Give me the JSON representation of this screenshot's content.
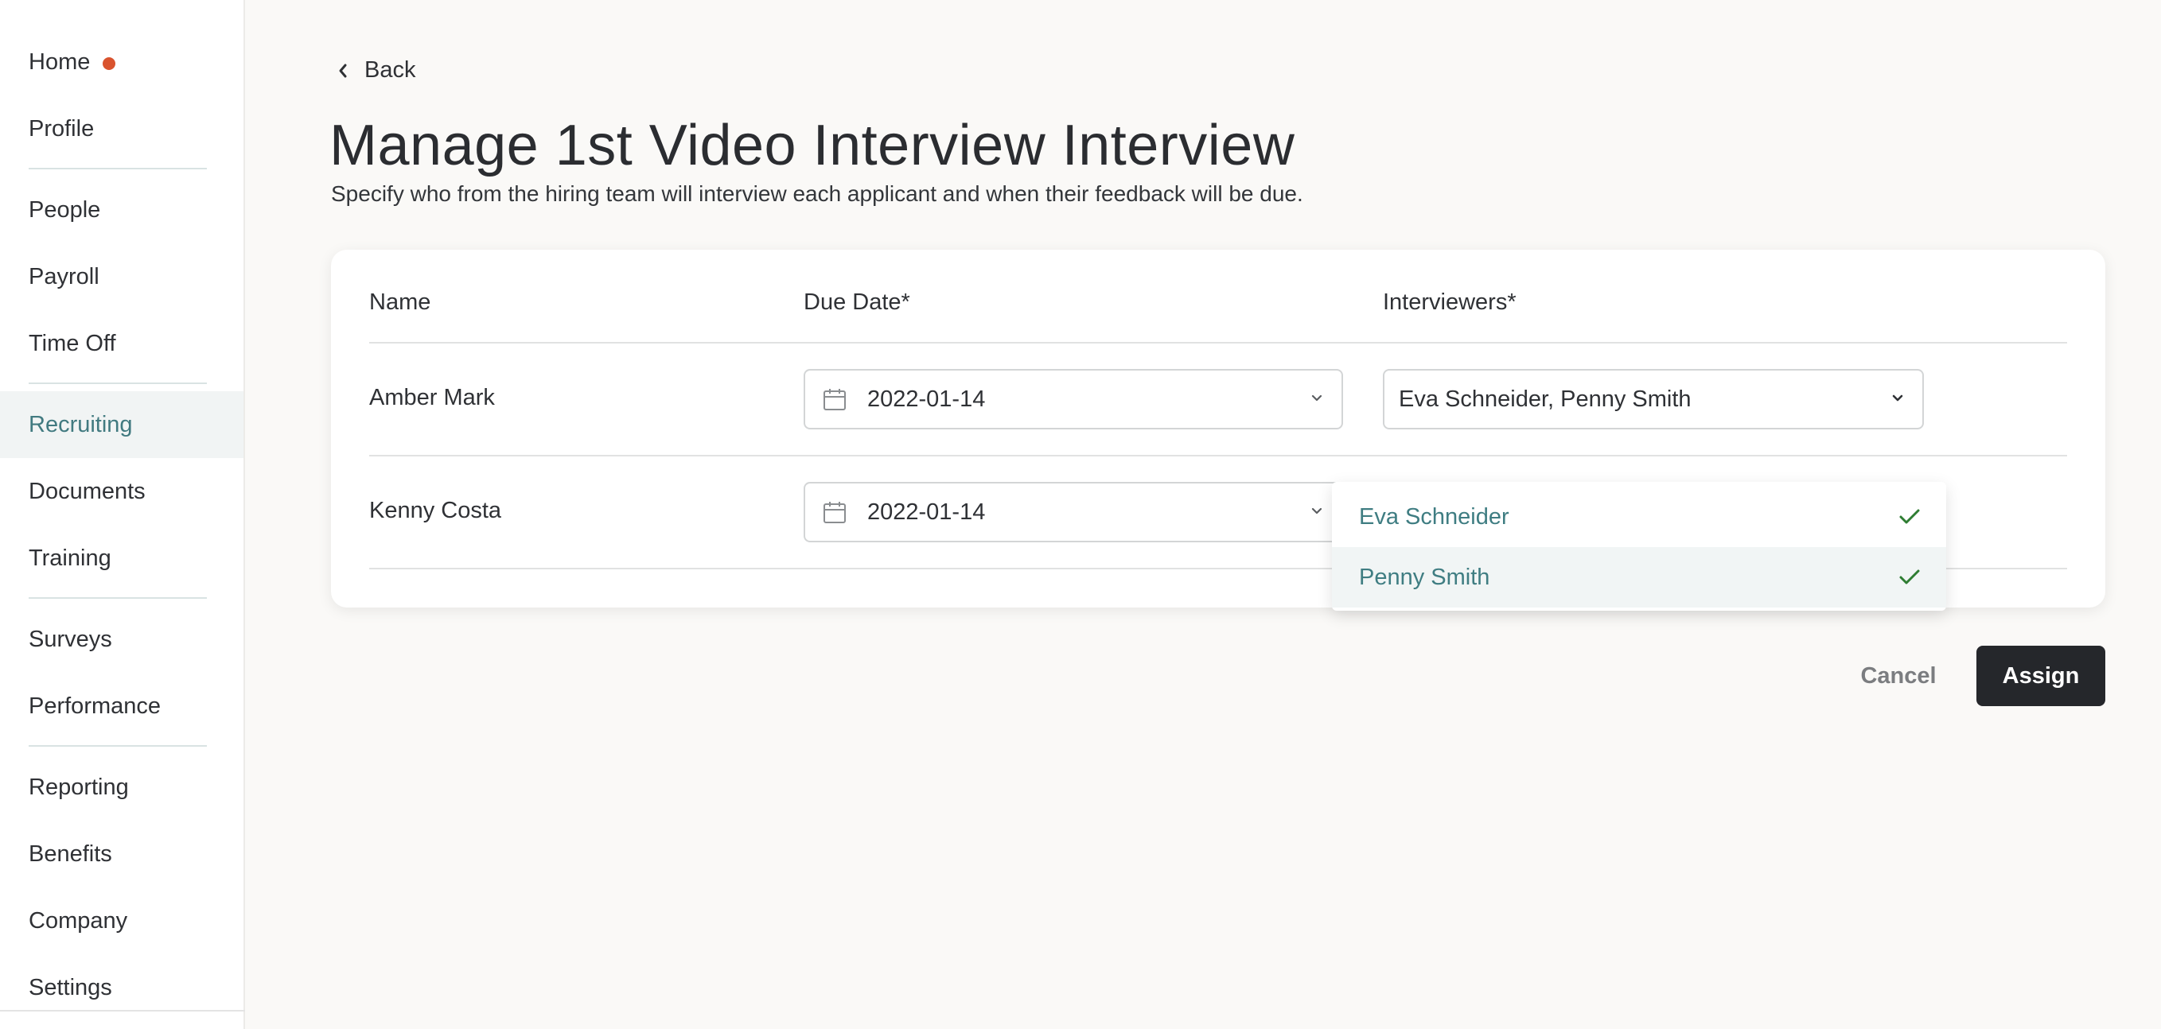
{
  "sidebar": {
    "items": [
      {
        "label": "Home"
      },
      {
        "label": "Profile"
      },
      {
        "label": "People"
      },
      {
        "label": "Payroll"
      },
      {
        "label": "Time Off"
      },
      {
        "label": "Recruiting"
      },
      {
        "label": "Documents"
      },
      {
        "label": "Training"
      },
      {
        "label": "Surveys"
      },
      {
        "label": "Performance"
      },
      {
        "label": "Reporting"
      },
      {
        "label": "Benefits"
      },
      {
        "label": "Company"
      },
      {
        "label": "Settings"
      }
    ],
    "active": "Recruiting",
    "notification_dot_color": "#d9532e"
  },
  "back_label": "Back",
  "page": {
    "title": "Manage 1st Video Interview Interview",
    "subtitle": "Specify who from the hiring team will interview each applicant and when their feedback will be due."
  },
  "table": {
    "headers": {
      "name": "Name",
      "due_date": "Due Date*",
      "interviewers": "Interviewers*"
    },
    "rows": [
      {
        "name": "Amber Mark",
        "due_date": "2022-01-14",
        "interviewers": "Eva Schneider, Penny Smith"
      },
      {
        "name": "Kenny Costa",
        "due_date": "2022-01-14",
        "interviewers": ""
      }
    ]
  },
  "dropdown": {
    "options": [
      {
        "label": "Eva Schneider",
        "selected": true
      },
      {
        "label": "Penny Smith",
        "selected": true
      }
    ]
  },
  "actions": {
    "cancel": "Cancel",
    "assign": "Assign"
  },
  "colors": {
    "accent": "#417a80",
    "check": "#2e7d32",
    "primary_button": "#25272b"
  }
}
